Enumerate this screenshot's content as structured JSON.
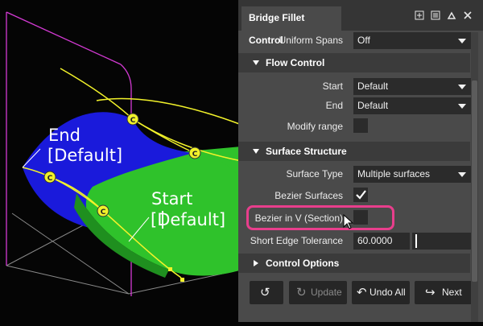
{
  "viewport": {
    "labels": {
      "end": "End",
      "end_default": "[Default]",
      "start": "Start",
      "start_default": "[Default]"
    },
    "colors": {
      "surface_blue": "#1a1adb",
      "surface_green": "#2fc22b",
      "curve_yellow": "#f2f22a",
      "frame_magenta": "#d43ad4",
      "background": "#050505"
    }
  },
  "panel": {
    "title": "Bridge Fillet Control",
    "header_icons": [
      "pin-icon",
      "menu-icon",
      "collapse-icon",
      "close-icon"
    ],
    "uniform_spans": {
      "label": "Uniform Spans",
      "value": "Off"
    },
    "flow_control": {
      "title": "Flow Control",
      "start": {
        "label": "Start",
        "value": "Default"
      },
      "end": {
        "label": "End",
        "value": "Default"
      },
      "modify_range": {
        "label": "Modify range",
        "checked": false
      }
    },
    "surface_structure": {
      "title": "Surface Structure",
      "surface_type": {
        "label": "Surface Type",
        "value": "Multiple surfaces"
      },
      "bezier_surfaces": {
        "label": "Bezier Surfaces",
        "checked": true
      },
      "bezier_in_v": {
        "label": "Bezier in V (Section)",
        "checked": false
      },
      "short_edge_tolerance": {
        "label": "Short Edge Tolerance",
        "value": "60.0000"
      }
    },
    "control_options": {
      "title": "Control Options"
    },
    "buttons": {
      "reset": "",
      "update": "Update",
      "undo_all": "Undo All",
      "next": "Next"
    },
    "colors": {
      "highlight": "#e83e8c",
      "panel_bg": "#4a4a4a",
      "section_bg": "#3b3b3b",
      "field_bg": "#2b2b2b"
    }
  }
}
